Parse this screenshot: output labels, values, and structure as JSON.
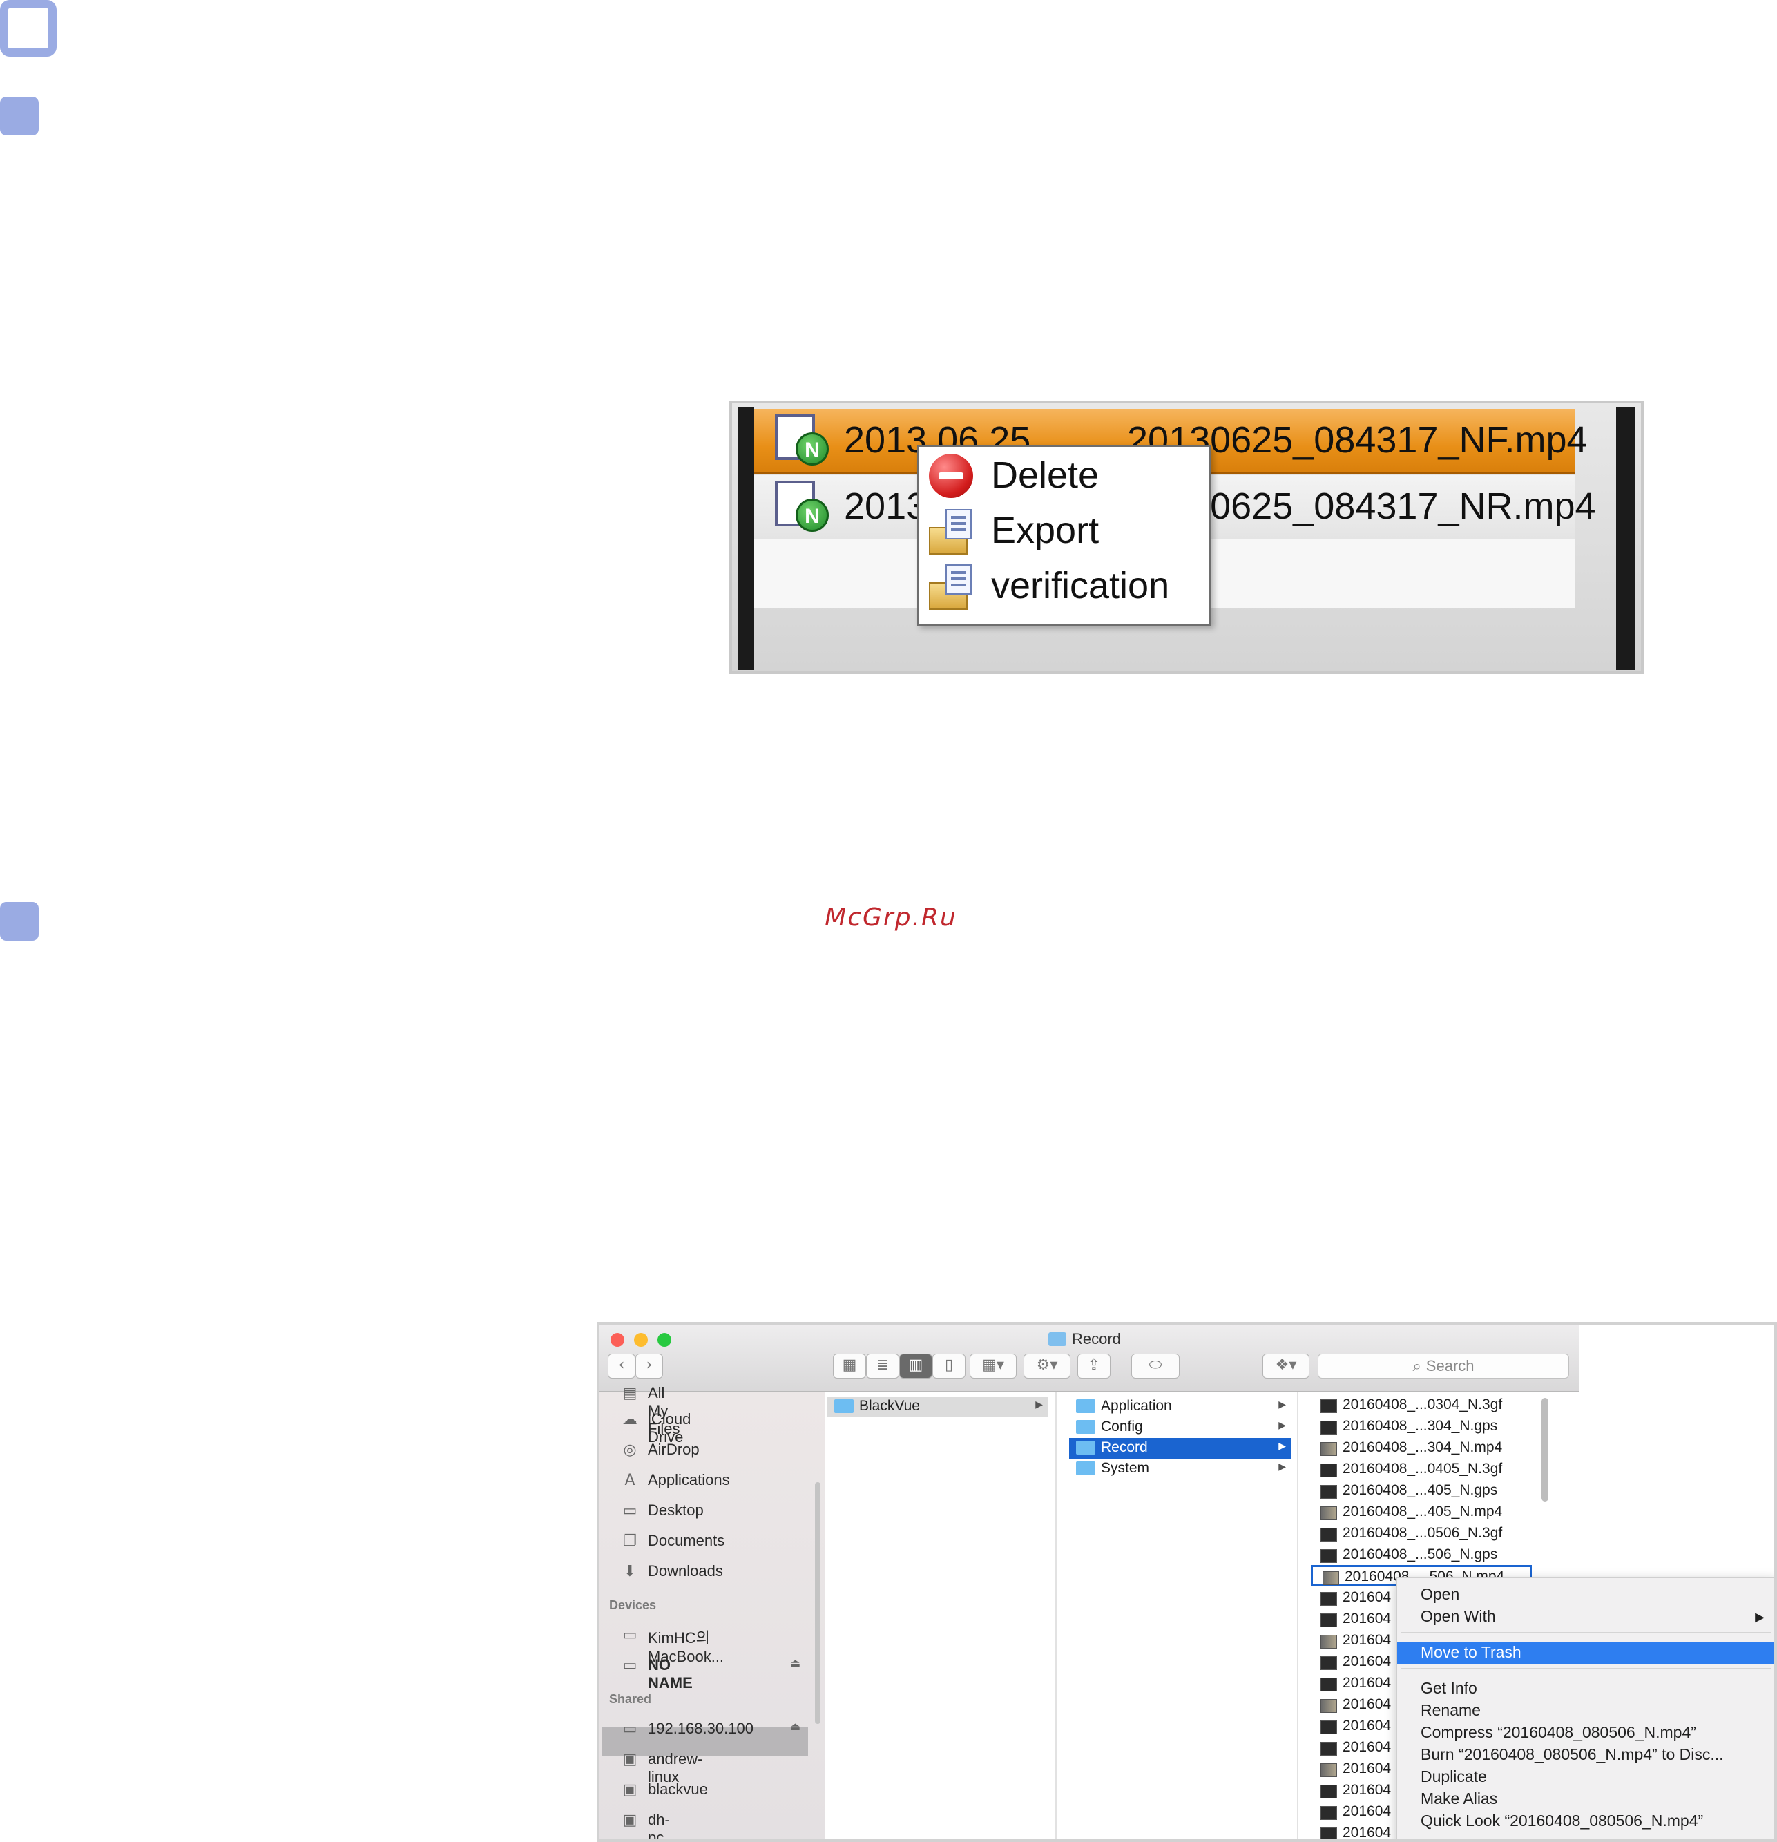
{
  "watermark": "McGrp.Ru",
  "viewer": {
    "rows": [
      {
        "date": "2013.06.25",
        "file": "20130625_084317_NF.mp4",
        "badge": "N"
      },
      {
        "date": "2013.06.25",
        "file": "20130625_084317_NR.mp4",
        "badge": "N"
      }
    ],
    "context_menu": [
      "Delete",
      "Export",
      "verification"
    ]
  },
  "finder": {
    "window_title": "Record",
    "search_placeholder": "Search",
    "sidebar": {
      "favorites": [
        {
          "label": "All My Files",
          "icon": "files-icon"
        },
        {
          "label": "iCloud Drive",
          "icon": "cloud-icon"
        },
        {
          "label": "AirDrop",
          "icon": "airdrop-icon"
        },
        {
          "label": "Applications",
          "icon": "applications-icon"
        },
        {
          "label": "Desktop",
          "icon": "desktop-icon"
        },
        {
          "label": "Documents",
          "icon": "documents-icon"
        },
        {
          "label": "Downloads",
          "icon": "downloads-icon"
        }
      ],
      "devices_header": "Devices",
      "devices": [
        {
          "label": "KimHC의 MacBook...",
          "icon": "laptop-icon"
        },
        {
          "label": "NO NAME",
          "icon": "drive-icon"
        }
      ],
      "shared_header": "Shared",
      "shared": [
        {
          "label": "192.168.30.100",
          "icon": "monitor-icon"
        },
        {
          "label": "andrew-linux",
          "icon": "computer-icon"
        },
        {
          "label": "blackvue",
          "icon": "computer-icon"
        },
        {
          "label": "dh-pc",
          "icon": "computer-icon"
        }
      ]
    },
    "column1": [
      "BlackVue"
    ],
    "column2": [
      "Application",
      "Config",
      "Record",
      "System"
    ],
    "files": [
      "20160408_...0304_N.3gf",
      "20160408_...304_N.gps",
      "20160408_...304_N.mp4",
      "20160408_...0405_N.3gf",
      "20160408_...405_N.gps",
      "20160408_...405_N.mp4",
      "20160408_...0506_N.3gf",
      "20160408_...506_N.gps",
      "20160408_...506_N.mp4",
      "201604",
      "201604",
      "201604",
      "201604",
      "201604",
      "201604",
      "201604",
      "201604",
      "201604",
      "201604",
      "201604",
      "201604"
    ],
    "context_menu": {
      "group1": [
        "Open",
        "Open With"
      ],
      "selected": "Move to Trash",
      "group2": [
        "Get Info",
        "Rename",
        "Compress “20160408_080506_N.mp4”",
        "Burn “20160408_080506_N.mp4” to Disc...",
        "Duplicate",
        "Make Alias",
        "Quick Look “20160408_080506_N.mp4”"
      ]
    }
  }
}
